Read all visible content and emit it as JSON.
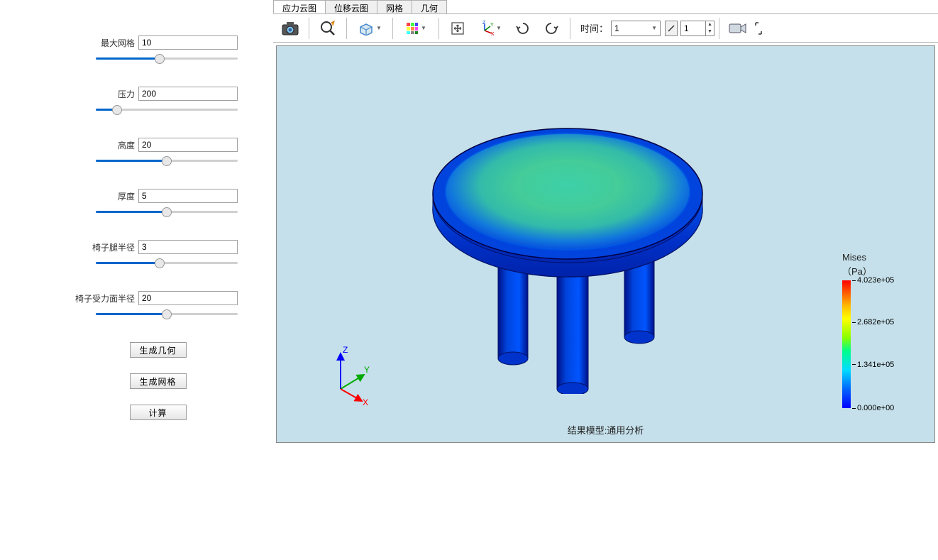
{
  "sidebar": {
    "params": [
      {
        "label": "最大网格",
        "value": "10",
        "fill": 45,
        "labelClass": "w1"
      },
      {
        "label": "压力",
        "value": "200",
        "fill": 15,
        "labelClass": "w2"
      },
      {
        "label": "高度",
        "value": "20",
        "fill": 50,
        "labelClass": "w2"
      },
      {
        "label": "厚度",
        "value": "5",
        "fill": 50,
        "labelClass": "w2"
      },
      {
        "label": "椅子腿半径",
        "value": "3",
        "fill": 45,
        "labelClass": "w3"
      },
      {
        "label": "椅子受力面半径",
        "value": "20",
        "fill": 50,
        "labelClass": "w4"
      }
    ],
    "buttons": {
      "gen_geometry": "生成几何",
      "gen_mesh": "生成网格",
      "compute": "计算"
    }
  },
  "tabs": [
    {
      "label": "应力云图",
      "active": true
    },
    {
      "label": "位移云图",
      "active": false
    },
    {
      "label": "网格",
      "active": false
    },
    {
      "label": "几何",
      "active": false
    }
  ],
  "toolbar": {
    "time_label": "时间：",
    "time_value": "1",
    "frame_value": "1"
  },
  "legend": {
    "title": "Mises",
    "unit": "（Pa）",
    "ticks": [
      {
        "pos": 0,
        "text": "4.023e+05"
      },
      {
        "pos": 33,
        "text": "2.682e+05"
      },
      {
        "pos": 66,
        "text": "1.341e+05"
      },
      {
        "pos": 100,
        "text": "0.000e+00"
      }
    ]
  },
  "caption": "结果模型:通用分析",
  "axes": {
    "x": "X",
    "y": "Y",
    "z": "Z"
  },
  "chart_data": {
    "type": "table",
    "description": "Von Mises stress contour (FEA result) on three-legged stool",
    "scalar_field": "Mises stress",
    "unit": "Pa",
    "range": {
      "min": 0.0,
      "max": 402300.0
    },
    "ticks": [
      402300.0,
      268200.0,
      134100.0,
      0.0
    ],
    "parameters": {
      "max_mesh": 10,
      "pressure": 200,
      "height": 20,
      "thickness": 5,
      "leg_radius": 3,
      "seat_radius": 20
    }
  }
}
